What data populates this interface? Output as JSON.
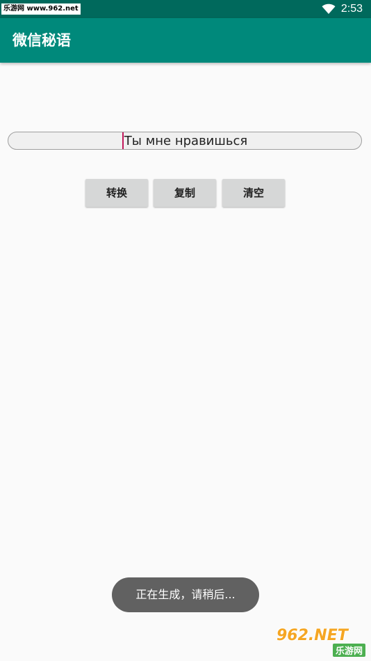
{
  "status_bar": {
    "watermark": "乐游网 www.962.net",
    "time": "2:53",
    "wifi_icon": "wifi-icon"
  },
  "app_bar": {
    "title": "微信秘语"
  },
  "input": {
    "value": "Ты мне нравишься"
  },
  "buttons": {
    "convert": "转换",
    "copy": "复制",
    "clear": "清空"
  },
  "toast": {
    "message": "正在生成，请稍后..."
  },
  "watermark_bottom": {
    "logo": "962.NET",
    "sub": "乐游网"
  },
  "colors": {
    "status_bar": "#00695c",
    "app_bar": "#00897b",
    "cursor": "#c2185b",
    "button": "#d6d7d7",
    "toast": "#616161"
  }
}
